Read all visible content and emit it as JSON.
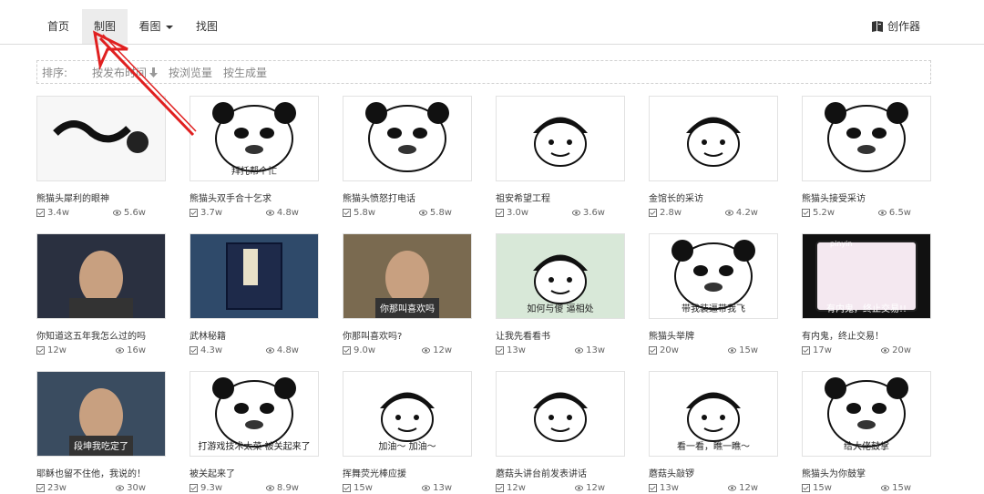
{
  "nav": {
    "items": [
      {
        "label": "首页"
      },
      {
        "label": "制图"
      },
      {
        "label": "看图"
      },
      {
        "label": "找图"
      }
    ],
    "creator_label": "创作器"
  },
  "sort": {
    "label": "排序:",
    "options": [
      "按发布时间",
      "按浏览量",
      "按生成量"
    ]
  },
  "cards": [
    {
      "title": "熊猫头犀利的眼神",
      "made": "3.4w",
      "views": "5.6w"
    },
    {
      "title": "熊猫头双手合十乞求",
      "made": "3.7w",
      "views": "4.8w",
      "caption": "拜托帮个忙"
    },
    {
      "title": "熊猫头愤怒打电话",
      "made": "5.8w",
      "views": "5.8w"
    },
    {
      "title": "祖安希望工程",
      "made": "3.0w",
      "views": "3.6w"
    },
    {
      "title": "金馆长的采访",
      "made": "2.8w",
      "views": "4.2w"
    },
    {
      "title": "熊猫头接受采访",
      "made": "5.2w",
      "views": "6.5w"
    },
    {
      "title": "你知道这五年我怎么过的吗",
      "made": "12w",
      "views": "16w"
    },
    {
      "title": "武林秘籍",
      "made": "4.3w",
      "views": "4.8w"
    },
    {
      "title": "你那叫喜欢吗?",
      "made": "9.0w",
      "views": "12w",
      "caption": "你那叫喜欢吗"
    },
    {
      "title": "让我先看看书",
      "made": "13w",
      "views": "13w",
      "caption": "如何与傻 逼相处"
    },
    {
      "title": "熊猫头举牌",
      "made": "20w",
      "views": "15w",
      "caption": "带我装逼带我飞"
    },
    {
      "title": "有内鬼，终止交易！",
      "made": "17w",
      "views": "20w",
      "caption": "有内鬼，终止交易!!",
      "app_label": "pinyin"
    },
    {
      "title": "耶稣也留不住他，我说的！",
      "made": "23w",
      "views": "30w",
      "caption": "段坤我吃定了"
    },
    {
      "title": "被关起来了",
      "made": "9.3w",
      "views": "8.9w",
      "caption": "打游戏技术太菜 被关起来了"
    },
    {
      "title": "挥舞荧光棒应援",
      "made": "15w",
      "views": "13w",
      "caption": "加油～ 加油～"
    },
    {
      "title": "蘑菇头讲台前发表讲话",
      "made": "12w",
      "views": "12w"
    },
    {
      "title": "蘑菇头敲锣",
      "made": "13w",
      "views": "12w",
      "caption": "看一看，瞧一瞧～"
    },
    {
      "title": "熊猫头为你鼓掌",
      "made": "15w",
      "views": "15w",
      "caption": "给大佬鼓掌"
    }
  ],
  "colors": {
    "arrow": "#e02020",
    "nav_active_bg": "#ececec",
    "border": "#dcdcdc"
  }
}
